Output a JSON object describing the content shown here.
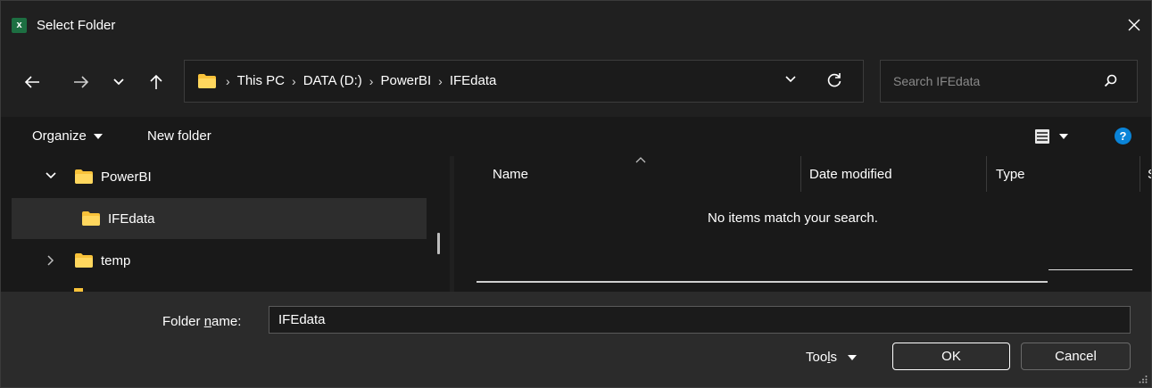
{
  "window": {
    "title": "Select Folder",
    "app_icon_letter": "x"
  },
  "address": {
    "crumbs": [
      "This PC",
      "DATA (D:)",
      "PowerBI",
      "IFEdata"
    ],
    "separator": "›"
  },
  "search": {
    "placeholder": "Search IFEdata"
  },
  "command_bar": {
    "organize_label": "Organize",
    "new_folder_label": "New folder",
    "help_label": "?"
  },
  "nav_tree": {
    "items": [
      {
        "label": "PowerBI",
        "expanded": true
      },
      {
        "label": "IFEdata",
        "selected": true
      },
      {
        "label": "temp",
        "expanded": false
      }
    ]
  },
  "file_list": {
    "columns": [
      "Name",
      "Date modified",
      "Type",
      "S"
    ],
    "empty_message": "No items match your search."
  },
  "footer": {
    "folder_name_label_prefix": "Folder ",
    "folder_name_label_hotkey": "n",
    "folder_name_label_suffix": "ame:",
    "folder_name_value": "IFEdata",
    "tools_prefix": "Too",
    "tools_hotkey": "l",
    "tools_suffix": "s",
    "ok_label": "OK",
    "cancel_label": "Cancel"
  },
  "colors": {
    "folder": "#f8c23a",
    "accent_blue": "#0a84d8",
    "excel_green": "#1d6f42",
    "background": "#202020"
  }
}
